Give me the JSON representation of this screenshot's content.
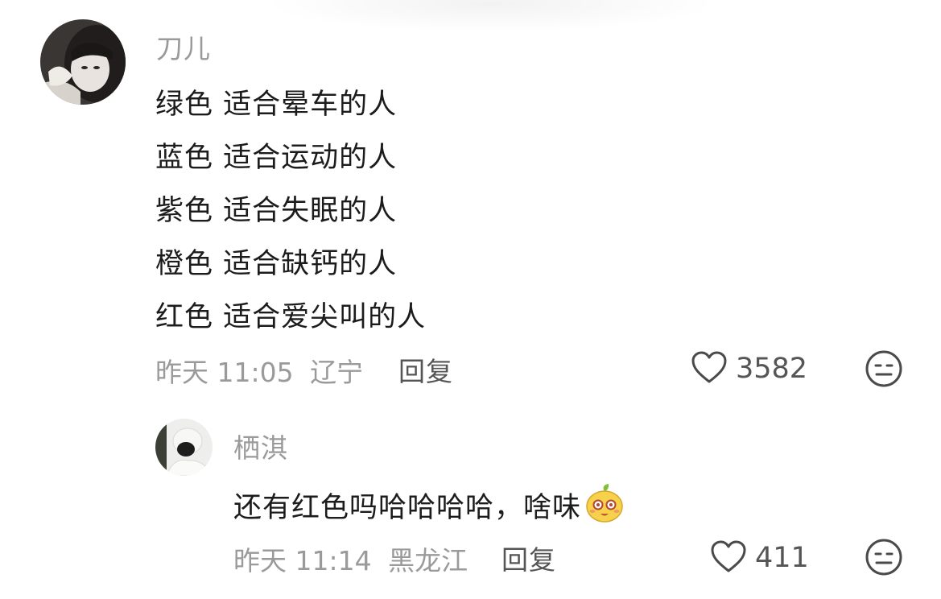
{
  "comment": {
    "author": "刀儿",
    "lines": [
      "绿色 适合晕车的人",
      "蓝色 适合运动的人",
      "紫色 适合失眠的人",
      "橙色 适合缺钙的人",
      "红色 适合爱尖叫的人"
    ],
    "time": "昨天 11:05",
    "location": "辽宁",
    "reply_label": "回复",
    "likes": "3582"
  },
  "reply": {
    "author": "栖淇",
    "text": "还有红色吗哈哈哈哈，啥味",
    "time": "昨天 11:14",
    "location": "黑龙江",
    "reply_label": "回复",
    "likes": "411"
  },
  "icons": {
    "like": "heart-outline-icon",
    "more": "meh-face-icon",
    "emoji": "mango-face-emoji"
  }
}
